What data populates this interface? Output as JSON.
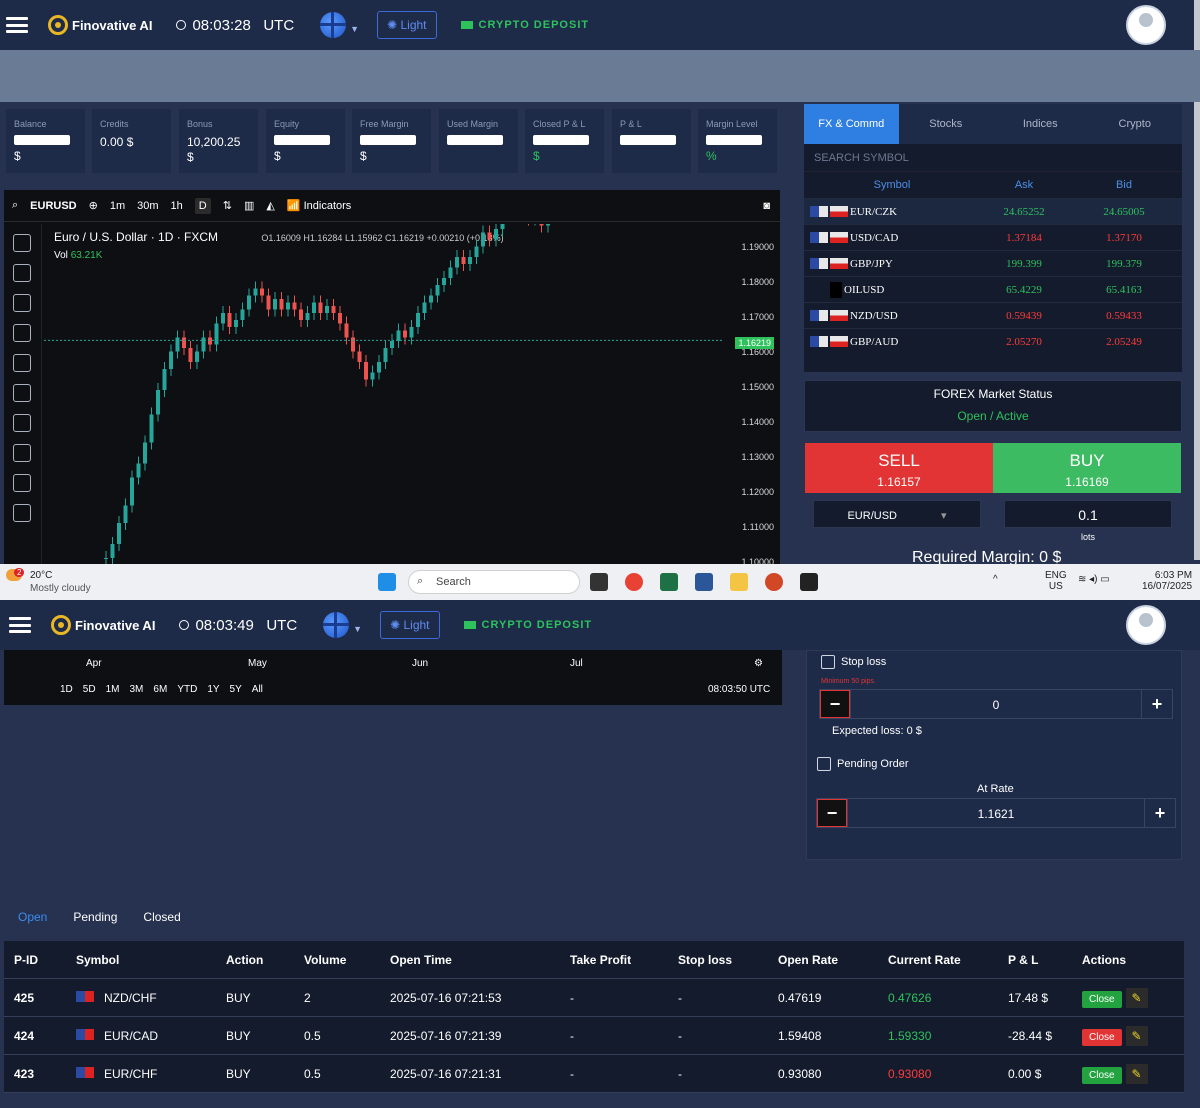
{
  "top": {
    "logo": "Finovative AI",
    "time": "08:03:28",
    "tz": "UTC",
    "light": "Light",
    "crypto": "CRYPTO DEPOSIT"
  },
  "cards": [
    {
      "label": "Balance",
      "value": "$"
    },
    {
      "label": "Credits",
      "value": "0.00 $"
    },
    {
      "label": "Bonus",
      "value": "10,200.25"
    },
    {
      "label": "Equity",
      "value": "$"
    },
    {
      "label": "Free Margin",
      "value": "$"
    },
    {
      "label": "Used Margin",
      "value": ""
    },
    {
      "label": "Closed P & L",
      "value": "$"
    },
    {
      "label": "P & L",
      "value": ""
    },
    {
      "label": "Margin Level",
      "value": "%"
    }
  ],
  "bonus_unit": "$",
  "chart": {
    "symbol": "EURUSD",
    "intervals": [
      "1m",
      "30m",
      "1h",
      "D"
    ],
    "indicators": "Indicators",
    "title": "Euro / U.S. Dollar · 1D · FXCM",
    "ohlc": "O1.16009 H1.16284 L1.15962 C1.16219 +0.00210 (+0.18%)",
    "vol": "Vol",
    "vol_val": "63.21K",
    "yticks": [
      "1.19000",
      "1.18000",
      "1.17000",
      "1.16000",
      "1.15000",
      "1.14000",
      "1.13000",
      "1.12000",
      "1.11000",
      "1.10000"
    ],
    "last": "1.16219"
  },
  "panel": {
    "tabs": [
      "FX & Commd",
      "Stocks",
      "Indices",
      "Crypto"
    ],
    "search": "SEARCH SYMBOL",
    "headers": [
      "Symbol",
      "Ask",
      "Bid"
    ],
    "rows": [
      {
        "s": "EUR/CZK",
        "a": "24.65252",
        "b": "24.65005",
        "c": "#2ec25d"
      },
      {
        "s": "USD/CAD",
        "a": "1.37184",
        "b": "1.37170",
        "c": "#ff3b3b"
      },
      {
        "s": "GBP/JPY",
        "a": "199.399",
        "b": "199.379",
        "c": "#2ec25d"
      },
      {
        "s": "OILUSD",
        "a": "65.4229",
        "b": "65.4163",
        "c": "#2ec25d"
      },
      {
        "s": "NZD/USD",
        "a": "0.59439",
        "b": "0.59433",
        "c": "#ff3b3b"
      },
      {
        "s": "GBP/AUD",
        "a": "2.05270",
        "b": "2.05249",
        "c": "#ff3b3b"
      }
    ],
    "status_title": "FOREX Market Status",
    "status": "Open / Active",
    "sell": "SELL",
    "sell_price": "1.16157",
    "buy": "BUY",
    "buy_price": "1.16169",
    "pair": "EUR/USD",
    "lots": "0.1",
    "lots_label": "lots",
    "req": "Required Margin: 0 $"
  },
  "taskbar": {
    "temp": "20°C",
    "weather": "Mostly cloudy",
    "search": "Search",
    "lang": "ENG",
    "region": "US",
    "time": "6:03 PM",
    "date": "16/07/2025",
    "badge": "2"
  },
  "second": {
    "time": "08:03:49",
    "tz": "UTC",
    "light": "Light",
    "crypto": "CRYPTO DEPOSIT",
    "logo": "Finovative AI"
  },
  "timeline": {
    "months": [
      "Apr",
      "May",
      "Jun",
      "Jul"
    ],
    "ranges": [
      "1D",
      "5D",
      "1M",
      "3M",
      "6M",
      "YTD",
      "1Y",
      "5Y",
      "All"
    ],
    "clock": "08:03:50 UTC"
  },
  "order": {
    "stop": "Stop loss",
    "min": "Minimum 50 pips.",
    "stop_val": "0",
    "expected": "Expected loss: 0 $",
    "pending": "Pending Order",
    "at_rate": "At Rate",
    "rate": "1.1621"
  },
  "tabs": [
    "Open",
    "Pending",
    "Closed"
  ],
  "table": {
    "headers": [
      "P-ID",
      "Symbol",
      "Action",
      "Volume",
      "Open Time",
      "Take Profit",
      "Stop loss",
      "Open Rate",
      "Current Rate",
      "P & L",
      "Actions"
    ],
    "rows": [
      {
        "id": "425",
        "sym": "NZD/CHF",
        "act": "BUY",
        "vol": "2",
        "time": "2025-07-16 07:21:53",
        "tp": "-",
        "sl": "-",
        "open": "0.47619",
        "cur": "0.47626",
        "curc": "#2ec25d",
        "pl": "17.48 $",
        "btn": "Close",
        "btnc": "#22a33f"
      },
      {
        "id": "424",
        "sym": "EUR/CAD",
        "act": "BUY",
        "vol": "0.5",
        "time": "2025-07-16 07:21:39",
        "tp": "-",
        "sl": "-",
        "open": "1.59408",
        "cur": "1.59330",
        "curc": "#2ec25d",
        "pl": "-28.44 $",
        "btn": "Close",
        "btnc": "#e23434"
      },
      {
        "id": "423",
        "sym": "EUR/CHF",
        "act": "BUY",
        "vol": "0.5",
        "time": "2025-07-16 07:21:31",
        "tp": "-",
        "sl": "-",
        "open": "0.93080",
        "cur": "0.93080",
        "curc": "#ff3b3b",
        "pl": "0.00 $",
        "btn": "Close",
        "btnc": "#22a33f"
      }
    ]
  }
}
